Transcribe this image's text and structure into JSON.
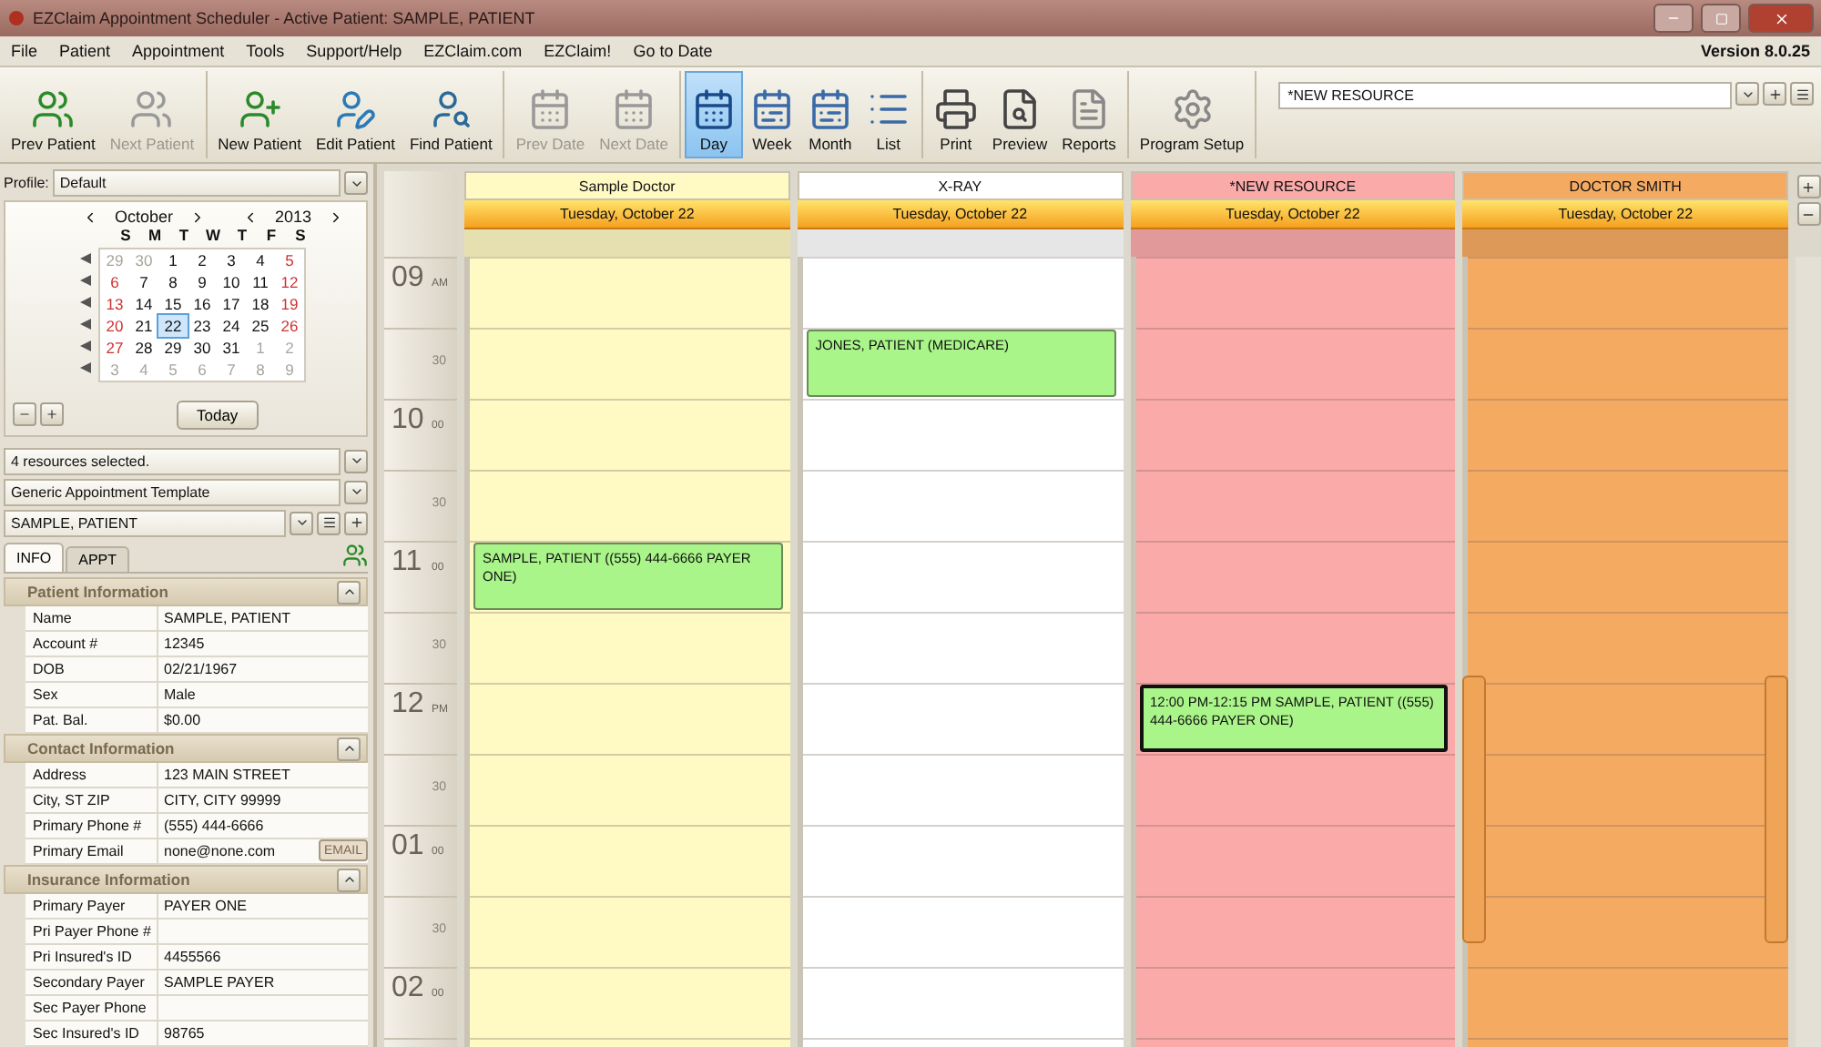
{
  "window": {
    "title": "EZClaim Appointment Scheduler - Active Patient: SAMPLE, PATIENT"
  },
  "menu": [
    "File",
    "Patient",
    "Appointment",
    "Tools",
    "Support/Help",
    "EZClaim.com",
    "EZClaim!",
    "Go to Date"
  ],
  "version": "Version 8.0.25",
  "toolbar_groups": [
    [
      {
        "label": "Prev Patient",
        "disabled": false,
        "selected": false
      },
      {
        "label": "Next Patient",
        "disabled": true,
        "selected": false
      }
    ],
    [
      {
        "label": "New Patient",
        "disabled": false,
        "selected": false
      },
      {
        "label": "Edit Patient",
        "disabled": false,
        "selected": false
      },
      {
        "label": "Find Patient",
        "disabled": false,
        "selected": false
      }
    ],
    [
      {
        "label": "Prev Date",
        "disabled": true,
        "selected": false
      },
      {
        "label": "Next Date",
        "disabled": true,
        "selected": false
      }
    ],
    [
      {
        "label": "Day",
        "disabled": false,
        "selected": true
      },
      {
        "label": "Week",
        "disabled": false,
        "selected": false
      },
      {
        "label": "Month",
        "disabled": false,
        "selected": false
      },
      {
        "label": "List",
        "disabled": false,
        "selected": false
      }
    ],
    [
      {
        "label": "Print",
        "disabled": false,
        "selected": false
      },
      {
        "label": "Preview",
        "disabled": false,
        "selected": false
      },
      {
        "label": "Reports",
        "disabled": false,
        "selected": false
      }
    ],
    [
      {
        "label": "Program Setup",
        "disabled": false,
        "selected": false
      }
    ]
  ],
  "resource_field": {
    "value": "*NEW RESOURCE"
  },
  "sidebar": {
    "profile": {
      "label": "Profile:",
      "value": "Default"
    },
    "mini_calendar": {
      "month": "October",
      "year": "2013",
      "weekdays": [
        "S",
        "M",
        "T",
        "W",
        "T",
        "F",
        "S"
      ],
      "weeks": [
        [
          {
            "day": "29",
            "other_month": true,
            "selected": false
          },
          {
            "day": "30",
            "other_month": true,
            "selected": false
          },
          {
            "day": "1",
            "other_month": false,
            "selected": false
          },
          {
            "day": "2",
            "other_month": false,
            "selected": false
          },
          {
            "day": "3",
            "other_month": false,
            "selected": false
          },
          {
            "day": "4",
            "other_month": false,
            "selected": false
          },
          {
            "day": "5",
            "other_month": false,
            "selected": false
          }
        ],
        [
          {
            "day": "6",
            "other_month": false,
            "selected": false
          },
          {
            "day": "7",
            "other_month": false,
            "selected": false
          },
          {
            "day": "8",
            "other_month": false,
            "selected": false
          },
          {
            "day": "9",
            "other_month": false,
            "selected": false
          },
          {
            "day": "10",
            "other_month": false,
            "selected": false
          },
          {
            "day": "11",
            "other_month": false,
            "selected": false
          },
          {
            "day": "12",
            "other_month": false,
            "selected": false
          }
        ],
        [
          {
            "day": "13",
            "other_month": false,
            "selected": false
          },
          {
            "day": "14",
            "other_month": false,
            "selected": false
          },
          {
            "day": "15",
            "other_month": false,
            "selected": false
          },
          {
            "day": "16",
            "other_month": false,
            "selected": false
          },
          {
            "day": "17",
            "other_month": false,
            "selected": false
          },
          {
            "day": "18",
            "other_month": false,
            "selected": false
          },
          {
            "day": "19",
            "other_month": false,
            "selected": false
          }
        ],
        [
          {
            "day": "20",
            "other_month": false,
            "selected": false
          },
          {
            "day": "21",
            "other_month": false,
            "selected": false
          },
          {
            "day": "22",
            "other_month": false,
            "selected": true
          },
          {
            "day": "23",
            "other_month": false,
            "selected": false
          },
          {
            "day": "24",
            "other_month": false,
            "selected": false
          },
          {
            "day": "25",
            "other_month": false,
            "selected": false
          },
          {
            "day": "26",
            "other_month": false,
            "selected": false
          }
        ],
        [
          {
            "day": "27",
            "other_month": false,
            "selected": false
          },
          {
            "day": "28",
            "other_month": false,
            "selected": false
          },
          {
            "day": "29",
            "other_month": false,
            "selected": false
          },
          {
            "day": "30",
            "other_month": false,
            "selected": false
          },
          {
            "day": "31",
            "other_month": false,
            "selected": false
          },
          {
            "day": "1",
            "other_month": true,
            "selected": false
          },
          {
            "day": "2",
            "other_month": true,
            "selected": false
          }
        ],
        [
          {
            "day": "3",
            "other_month": true,
            "selected": false
          },
          {
            "day": "4",
            "other_month": true,
            "selected": false
          },
          {
            "day": "5",
            "other_month": true,
            "selected": false
          },
          {
            "day": "6",
            "other_month": true,
            "selected": false
          },
          {
            "day": "7",
            "other_month": true,
            "selected": false
          },
          {
            "day": "8",
            "other_month": true,
            "selected": false
          },
          {
            "day": "9",
            "other_month": true,
            "selected": false
          }
        ]
      ],
      "today_button": "Today"
    },
    "resources": "4 resources selected.",
    "template": "Generic Appointment Template",
    "patient": "SAMPLE, PATIENT",
    "tabs": [
      {
        "label": "INFO",
        "selected": true
      },
      {
        "label": "APPT",
        "selected": false
      }
    ],
    "sections": [
      {
        "title": "Patient Information",
        "expanded": true,
        "rows": [
          {
            "label": "Name",
            "value": "SAMPLE, PATIENT"
          },
          {
            "label": "Account #",
            "value": "12345"
          },
          {
            "label": "DOB",
            "value": "02/21/1967"
          },
          {
            "label": "Sex",
            "value": "Male"
          },
          {
            "label": "Pat. Bal.",
            "value": "$0.00"
          }
        ]
      },
      {
        "title": "Contact Information",
        "expanded": true,
        "rows": [
          {
            "label": "Address",
            "value": "123 MAIN STREET"
          },
          {
            "label": "City, ST ZIP",
            "value": "CITY, CITY 99999"
          },
          {
            "label": "Primary Phone #",
            "value": "(555) 444-6666"
          },
          {
            "label": "Primary Email",
            "value": "none@none.com",
            "button": "EMAIL"
          }
        ]
      },
      {
        "title": "Insurance Information",
        "expanded": true,
        "rows": [
          {
            "label": "Primary Payer",
            "value": "PAYER ONE"
          },
          {
            "label": "Pri Payer Phone #"
          },
          {
            "label": "Pri Insured's ID",
            "value": "4455566"
          },
          {
            "label": "Secondary Payer",
            "value": "SAMPLE PAYER"
          },
          {
            "label": "Sec Payer Phone"
          },
          {
            "label": "Sec Insured's ID",
            "value": "98765"
          }
        ]
      }
    ]
  },
  "schedule": {
    "time_slots": [
      {
        "hour": "09",
        "suffix": "AM"
      },
      {
        "minute": "30"
      },
      {
        "hour": "10",
        "suffix": "00"
      },
      {
        "minute": "30"
      },
      {
        "hour": "11",
        "suffix": "00"
      },
      {
        "minute": "30"
      },
      {
        "hour": "12",
        "suffix": "PM"
      },
      {
        "minute": "30"
      },
      {
        "hour": "01",
        "suffix": "00"
      },
      {
        "minute": "30"
      },
      {
        "hour": "02",
        "suffix": "00"
      }
    ],
    "columns": [
      {
        "name": "Sample Doctor",
        "date": "Tuesday, October 22",
        "color": "#fff9c4",
        "slots": [
          {
            "booked": false
          },
          {
            "booked": false
          },
          {
            "booked": false
          },
          {
            "booked": false
          },
          {
            "booked": true,
            "text": "SAMPLE, PATIENT ((555) 444-6666 PAYER ONE)",
            "selected": false
          }
        ]
      },
      {
        "name": "X-RAY",
        "date": "Tuesday, October 22",
        "color": "#ffffff",
        "slots": [
          {
            "booked": false
          },
          {
            "booked": true,
            "text": "JONES, PATIENT (MEDICARE)",
            "selected": false
          }
        ]
      },
      {
        "name": "*NEW RESOURCE",
        "date": "Tuesday, October 22",
        "color": "#fbaaaa",
        "slots": [
          {
            "booked": false
          },
          {
            "booked": false
          },
          {
            "booked": false
          },
          {
            "booked": false
          },
          {
            "booked": false
          },
          {
            "booked": false
          },
          {
            "booked": true,
            "text": "12:00 PM-12:15 PM SAMPLE, PATIENT ((555) 444-6666 PAYER ONE)",
            "selected": true
          }
        ]
      },
      {
        "name": "DOCTOR SMITH",
        "date": "Tuesday, October 22",
        "color": "#f5aa62"
      }
    ]
  }
}
